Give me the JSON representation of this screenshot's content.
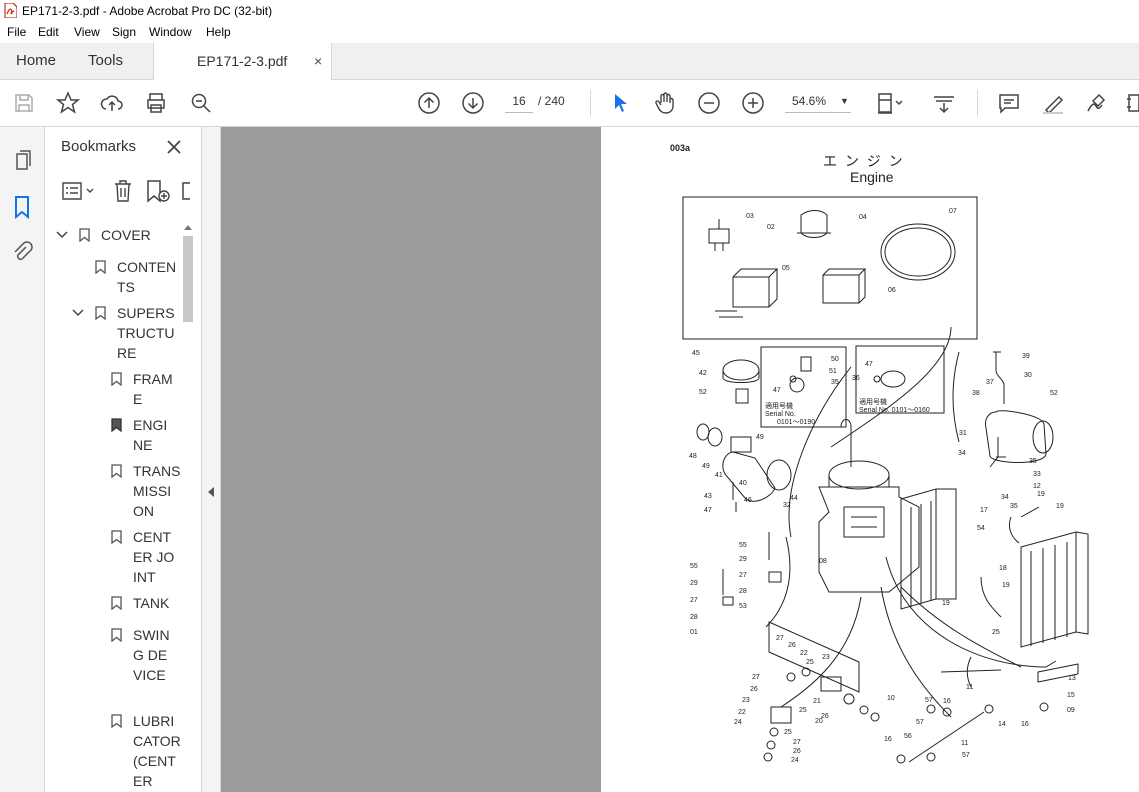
{
  "window": {
    "title": "EP171-2-3.pdf - Adobe Acrobat Pro DC (32-bit)"
  },
  "menu": [
    "File",
    "Edit",
    "View",
    "Sign",
    "Window",
    "Help"
  ],
  "tabs": {
    "home": "Home",
    "tools": "Tools",
    "document": "EP171-2-3.pdf",
    "close": "×"
  },
  "toolbar": {
    "page_current": "16",
    "page_total": "/ 240",
    "zoom": "54.6%"
  },
  "bookmarks": {
    "title": "Bookmarks",
    "items": [
      {
        "label": "COVER"
      },
      {
        "label": "CONTENTS"
      },
      {
        "label": "SUPERSTRUCTURE"
      },
      {
        "label": "FRAME"
      },
      {
        "label": "ENGINE"
      },
      {
        "label": "TRANSMISSION"
      },
      {
        "label": "CENTER JOINT"
      },
      {
        "label": "TANK"
      },
      {
        "label": "SWING DEVICE"
      },
      {
        "label": "LUBRICATOR (CENTER"
      }
    ]
  },
  "page": {
    "code": "003a",
    "title_jp": "エ ン ジ ン",
    "title_en": "Engine",
    "serial_label_1": "適用号機",
    "serial_text_1": "Serial No.",
    "serial_range_1": "0101～0190",
    "serial_label_2": "適用号機",
    "serial_text_2": "Serial No. 0101～0160"
  },
  "parts_labels": [
    "03",
    "02",
    "04",
    "07",
    "05",
    "06",
    "42",
    "52",
    "47",
    "50",
    "51",
    "35",
    "47",
    "36",
    "39",
    "37",
    "38",
    "30",
    "52",
    "45",
    "49",
    "48",
    "49",
    "41",
    "40",
    "46",
    "44",
    "43",
    "47",
    "32",
    "31",
    "34",
    "35",
    "33",
    "12",
    "34",
    "35",
    "17",
    "19",
    "19",
    "54",
    "55",
    "29",
    "27",
    "28",
    "53",
    "55",
    "29",
    "27",
    "28",
    "01",
    "08",
    "19",
    "18",
    "19",
    "25",
    "27",
    "26",
    "22",
    "23",
    "25",
    "27",
    "26",
    "23",
    "22",
    "24",
    "26",
    "25",
    "27",
    "26",
    "24",
    "21",
    "20",
    "25",
    "10",
    "57",
    "16",
    "11",
    "14",
    "13",
    "15",
    "16",
    "09",
    "57",
    "56",
    "16",
    "11",
    "57"
  ]
}
